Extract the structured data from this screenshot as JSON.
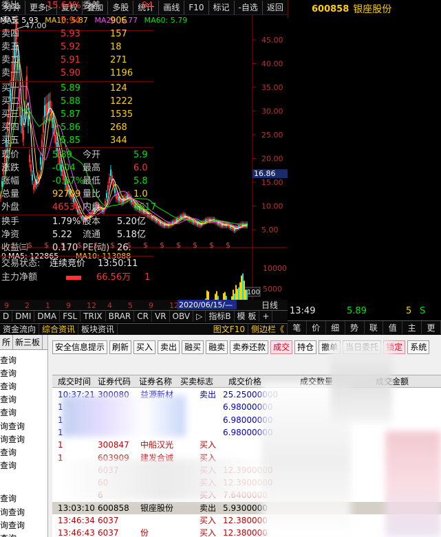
{
  "toolbar": {
    "items": [
      "分钟",
      "更多▷",
      "复权",
      "叠加",
      "多股",
      "统计",
      "画线",
      "F10",
      "标记",
      "-自选",
      "返回"
    ]
  },
  "stock": {
    "code": "600858",
    "name": "银座股份"
  },
  "ma_legend": {
    "ma5": "MA5: 5.93",
    "ma10": "MA10: 5.87",
    "ma20": "MA20: 5.77",
    "ma60": "MA60: 5.79",
    "colors": {
      "ma5": "#ffffff",
      "ma10": "#ffd000",
      "ma20": "#ff40ff",
      "ma60": "#00e600"
    }
  },
  "price_chart": {
    "y_ticks": [
      "45.00",
      "40.00",
      "35.00",
      "30.00",
      "25.00",
      "20.00",
      "15.00",
      "10.00",
      "5.00"
    ],
    "high_label": "47.00",
    "current_price_label": "16.86"
  },
  "volume_chart": {
    "legend_prefix": "9",
    "ma5": "MA5: 122865",
    "ma10": "MA10: 113088",
    "y_ticks": [
      "10000",
      "5000"
    ],
    "unit": "X100"
  },
  "date_axis": {
    "labels": [
      "9",
      "2",
      "1",
      "9",
      "12",
      "4",
      "5",
      "9",
      "12",
      "8"
    ],
    "cursor_date": "2020/06/15/—",
    "period": "日线"
  },
  "indicator_tabs": [
    "D",
    "DMI",
    "DMA",
    "FSL",
    "TRIX",
    "BRAR",
    "CR",
    "VR",
    "OBV",
    "▷",
    "指标B",
    "模 板",
    "+"
  ],
  "sub_tabs": [
    "资金流向",
    "综合资讯",
    "板块资讯"
  ],
  "right_tabs_small": [
    "图文F10",
    "侧边栏《"
  ],
  "quote": {
    "weibi_label": "委比",
    "weibi_value": "15.64%",
    "weicha_label": "委差",
    "weicha_value": "94",
    "asks": [
      {
        "label": "卖五",
        "price": "5.94",
        "vol": "906"
      },
      {
        "label": "卖四",
        "price": "5.93",
        "vol": "157"
      },
      {
        "label": "卖三",
        "price": "5.92",
        "vol": "18"
      },
      {
        "label": "卖二",
        "price": "5.91",
        "vol": "271"
      },
      {
        "label": "卖一",
        "price": "5.90",
        "vol": "1196"
      }
    ],
    "bids": [
      {
        "label": "买一",
        "price": "5.89",
        "vol": "124"
      },
      {
        "label": "买二",
        "price": "5.88",
        "vol": "1222"
      },
      {
        "label": "买三",
        "price": "5.87",
        "vol": "1535"
      },
      {
        "label": "买四",
        "price": "5.86",
        "vol": "268"
      },
      {
        "label": "买五",
        "price": "5.85",
        "vol": "344"
      }
    ],
    "stats": [
      {
        "l1": "现价",
        "v1": "5.89",
        "l2": "今开",
        "v2": "5.9"
      },
      {
        "l1": "涨跌",
        "v1": "-0.04",
        "l2": "最高",
        "v2": "6.0"
      },
      {
        "l1": "涨幅",
        "v1": "-0.67%",
        "l2": "最低",
        "v2": "5.8"
      },
      {
        "l1": "总量",
        "v1": "92709",
        "l2": "量比",
        "v2": "1.0"
      },
      {
        "l1": "外盘",
        "v1": "46535",
        "l2": "内盘",
        "v2": "4617"
      }
    ],
    "stats2": [
      {
        "l1": "换手",
        "v1": "1.79%",
        "l2": "股本",
        "v2": "5.20亿"
      },
      {
        "l1": "净资",
        "v1": "5.22",
        "l2": "流通",
        "v2": "5.18亿"
      },
      {
        "l1": "收益㈢",
        "v1": "0.170",
        "l2": "PE(动)",
        "v2": "26."
      }
    ],
    "trade_status_label": "交易状态:",
    "trade_status_value": "连续竞价",
    "trade_status_time": "13:50:11",
    "net_inflow_label": "主力净额",
    "net_inflow_value": "66.56万",
    "net_inflow_extra": "1"
  },
  "tick": {
    "time": "13:49",
    "price": "5.89",
    "vol": "5",
    "side": "S"
  },
  "right_tabs": [
    "笔",
    "价",
    "细",
    "势",
    "联",
    "值",
    "主",
    "更"
  ],
  "trade_panel": {
    "side_tabs": [
      "所",
      "新三板"
    ],
    "side_items": [
      "查询",
      "查询",
      "查询",
      "查询",
      "查询",
      "询查询",
      "询查询",
      "查询",
      "查询",
      "查询",
      "询查询",
      "询查询",
      "查询"
    ],
    "buttons": [
      "安全信息提示",
      "刷新",
      "买入",
      "卖出",
      "融买",
      "融卖",
      "卖券还款",
      "成交",
      "持仓",
      "撤单",
      "当日委托",
      "锁定",
      "系统"
    ],
    "columns": [
      "成交时间",
      "证券代码",
      "证券名称",
      "买卖标志",
      "成交价格",
      "成交数量",
      "成交金额"
    ],
    "rows": [
      {
        "time": "10:37:21",
        "code": "300080",
        "name": "益源新材",
        "side": "卖出",
        "price": "25.25000000",
        "color": "#0000c0"
      },
      {
        "time": "1",
        "code": "",
        "name": "",
        "side": "",
        "price": "6.98000000",
        "color": "#0000c0"
      },
      {
        "time": "1",
        "code": "",
        "name": "",
        "side": "",
        "price": "6.98000000",
        "color": "#0000c0"
      },
      {
        "time": "1",
        "code": "",
        "name": "",
        "side": "",
        "price": "6.98000000",
        "color": "#0000c0"
      },
      {
        "time": "1",
        "code": "300847",
        "name": "中船汉光",
        "side": "买入",
        "price": "",
        "color": "#c00000"
      },
      {
        "time": "1",
        "code": "603909",
        "name": "建发合诚",
        "side": "买入",
        "price": "",
        "color": "#c00000"
      },
      {
        "time": "",
        "code": "6037",
        "name": "",
        "side": "买入",
        "price": "12.3900000",
        "color": "#c00000"
      },
      {
        "time": "",
        "code": "60",
        "name": "",
        "side": "买入",
        "price": "12.3900000",
        "color": "#c00000"
      },
      {
        "time": "",
        "code": "6",
        "name": "",
        "side": "买入",
        "price": "7.6400000",
        "color": "#c00000"
      },
      {
        "time": "13:03:10",
        "code": "600858",
        "name": "银座股份",
        "side": "卖出",
        "price": "5.9300000",
        "color": "#000000"
      },
      {
        "time": "13:46:34",
        "code": "6037",
        "name": "",
        "side": "买入",
        "price": "12.380000",
        "color": "#c00000"
      },
      {
        "time": "13:46:43",
        "code": "6037",
        "name": "份",
        "side": "买入",
        "price": "12.380000",
        "color": "#c00000"
      }
    ]
  }
}
